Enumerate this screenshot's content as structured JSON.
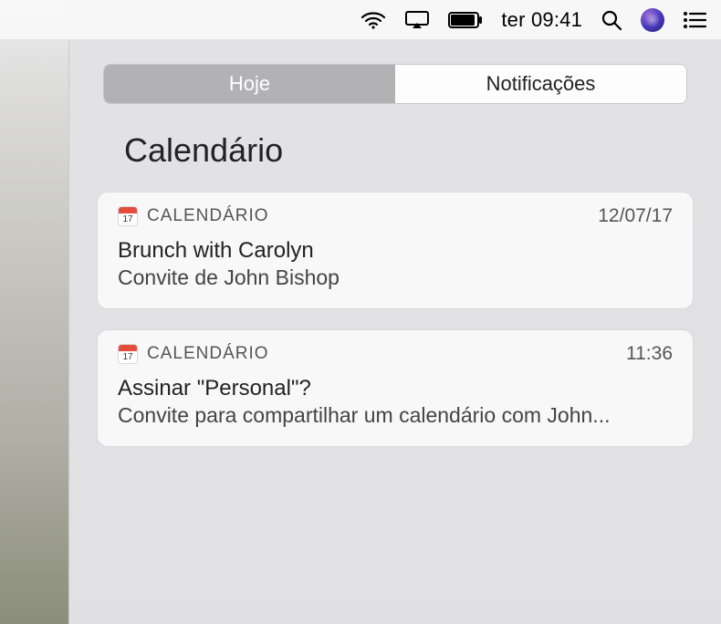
{
  "menubar": {
    "clock": "ter 09:41"
  },
  "segmented": {
    "today": "Hoje",
    "notifications": "Notificações"
  },
  "section": {
    "title": "Calendário"
  },
  "notifications": [
    {
      "app": "CALENDÁRIO",
      "time": "12/07/17",
      "title": "Brunch with Carolyn",
      "subtitle": "Convite de John Bishop"
    },
    {
      "app": "CALENDÁRIO",
      "time": "11:36",
      "title": "Assinar \"Personal\"?",
      "subtitle": "Convite para compartilhar um calendário com John..."
    }
  ]
}
